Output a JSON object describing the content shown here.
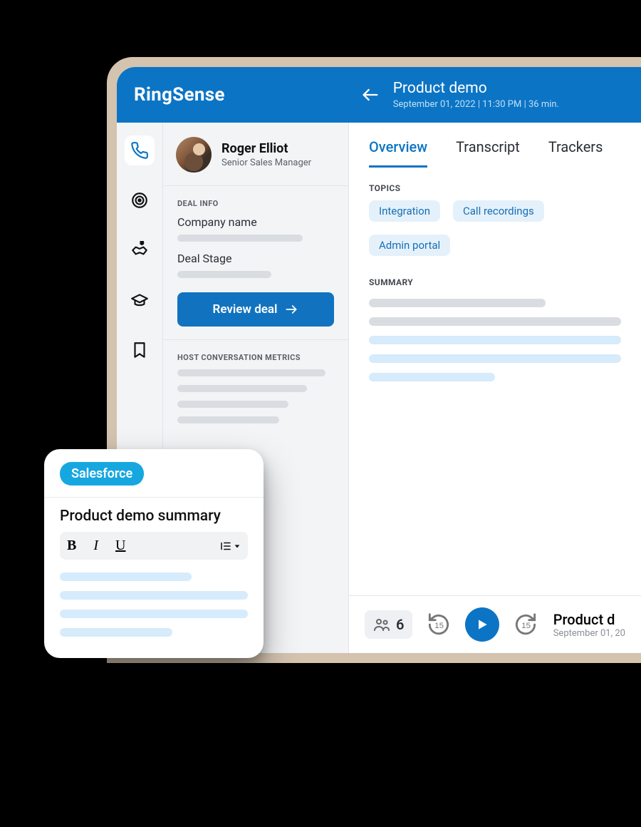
{
  "colors": {
    "brand": "#0c74c4",
    "chipBg": "#e4f1fb",
    "chipText": "#196fb4",
    "sfBlue": "#17a7e0"
  },
  "header": {
    "brand": "RingSense",
    "title": "Product demo",
    "meta": "September 01, 2022  |  11:30 PM  |  36 min."
  },
  "nav": {
    "items": [
      "phone",
      "target",
      "handshake",
      "graduation",
      "bookmark"
    ],
    "activeIndex": 0
  },
  "profile": {
    "name": "Roger Elliot",
    "role": "Senior Sales Manager"
  },
  "dealInfo": {
    "section_label": "DEAL INFO",
    "company_label": "Company name",
    "stage_label": "Deal Stage",
    "review_label": "Review deal"
  },
  "metrics": {
    "section_label": "HOST CONVERSATION METRICS"
  },
  "tabs": {
    "items": [
      "Overview",
      "Transcript",
      "Trackers"
    ],
    "activeIndex": 0
  },
  "topics": {
    "label": "TOPICS",
    "items": [
      "Integration",
      "Call recordings",
      "Admin portal"
    ]
  },
  "summary": {
    "label": "SUMMARY"
  },
  "player": {
    "participants": 6,
    "skip_seconds": 15,
    "title": "Product d",
    "meta": "September 01, 20"
  },
  "card": {
    "badge": "Salesforce",
    "title": "Product demo summary",
    "toolbar": {
      "bold": "B",
      "italic": "I",
      "underline": "U"
    }
  }
}
